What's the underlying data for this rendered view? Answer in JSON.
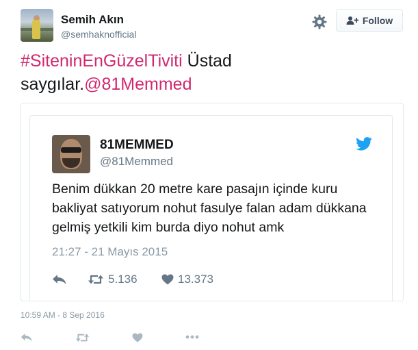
{
  "author": {
    "name": "Semih Akın",
    "handle": "@semhaknofficial"
  },
  "follow_button": {
    "label": "Follow"
  },
  "tweet": {
    "hashtag": "#SiteninEnGüzelTiviti",
    "text_middle": " Üstad saygılar.",
    "mention": "@81Memmed"
  },
  "quoted_tweet": {
    "name": "81MEMMED",
    "handle": "@81Memmed",
    "text": "Benim dükkan 20 metre kare pasajın içinde kuru bakliyat satıyorum nohut fasulye falan adam dükkana gelmiş yetkili kim burda diyo nohut amk",
    "timestamp": "21:27 - 21 Mayıs 2015",
    "retweets": "5.136",
    "likes": "13.373"
  },
  "timestamp": "10:59 AM - 8 Sep 2016",
  "colors": {
    "accent_pink": "#d1286f",
    "twitter_blue": "#1da1f2",
    "muted_gray": "#657786",
    "light_gray": "#8899a6",
    "border": "#e1e8ed"
  },
  "icons": {
    "gear": "gear-icon",
    "follow": "add-user-icon",
    "twitter_bird": "twitter-bird-icon",
    "reply": "reply-icon",
    "retweet": "retweet-icon",
    "like": "heart-icon",
    "more": "more-dots-icon"
  }
}
